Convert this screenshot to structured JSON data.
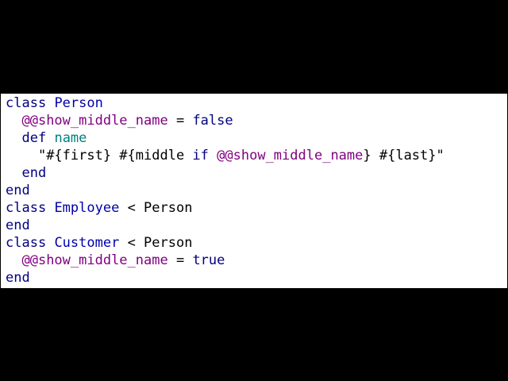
{
  "colors": {
    "background": "#000000",
    "panel": "#ffffff",
    "keyword": "#000080",
    "class_name": "#0000aa",
    "method_name": "#008080",
    "class_variable": "#800080",
    "text": "#000000"
  },
  "code": {
    "l1": {
      "kw": "class",
      "sp": " ",
      "name": "Person"
    },
    "l2": {
      "indent": "  ",
      "cvar": "@@show_middle_name",
      "op": " = ",
      "val": "false"
    },
    "l3": {
      "indent": "  ",
      "kw": "def",
      "sp": " ",
      "name": "name"
    },
    "l4": {
      "indent": "    ",
      "s1": "\"#{first} #{middle ",
      "kw": "if",
      "sp": " ",
      "cvar": "@@show_middle_name",
      "s2": "} #{last}\""
    },
    "l5": {
      "indent": "  ",
      "kw": "end"
    },
    "l6": {
      "kw": "end"
    },
    "l7": {
      "kw": "class",
      "sp": " ",
      "name": "Employee",
      "rest": " < Person"
    },
    "l8": {
      "kw": "end"
    },
    "l9": {
      "kw": "class",
      "sp": " ",
      "name": "Customer",
      "rest": " < Person"
    },
    "l10": {
      "indent": "  ",
      "cvar": "@@show_middle_name",
      "op": " = ",
      "val": "true"
    },
    "l11": {
      "kw": "end"
    }
  }
}
